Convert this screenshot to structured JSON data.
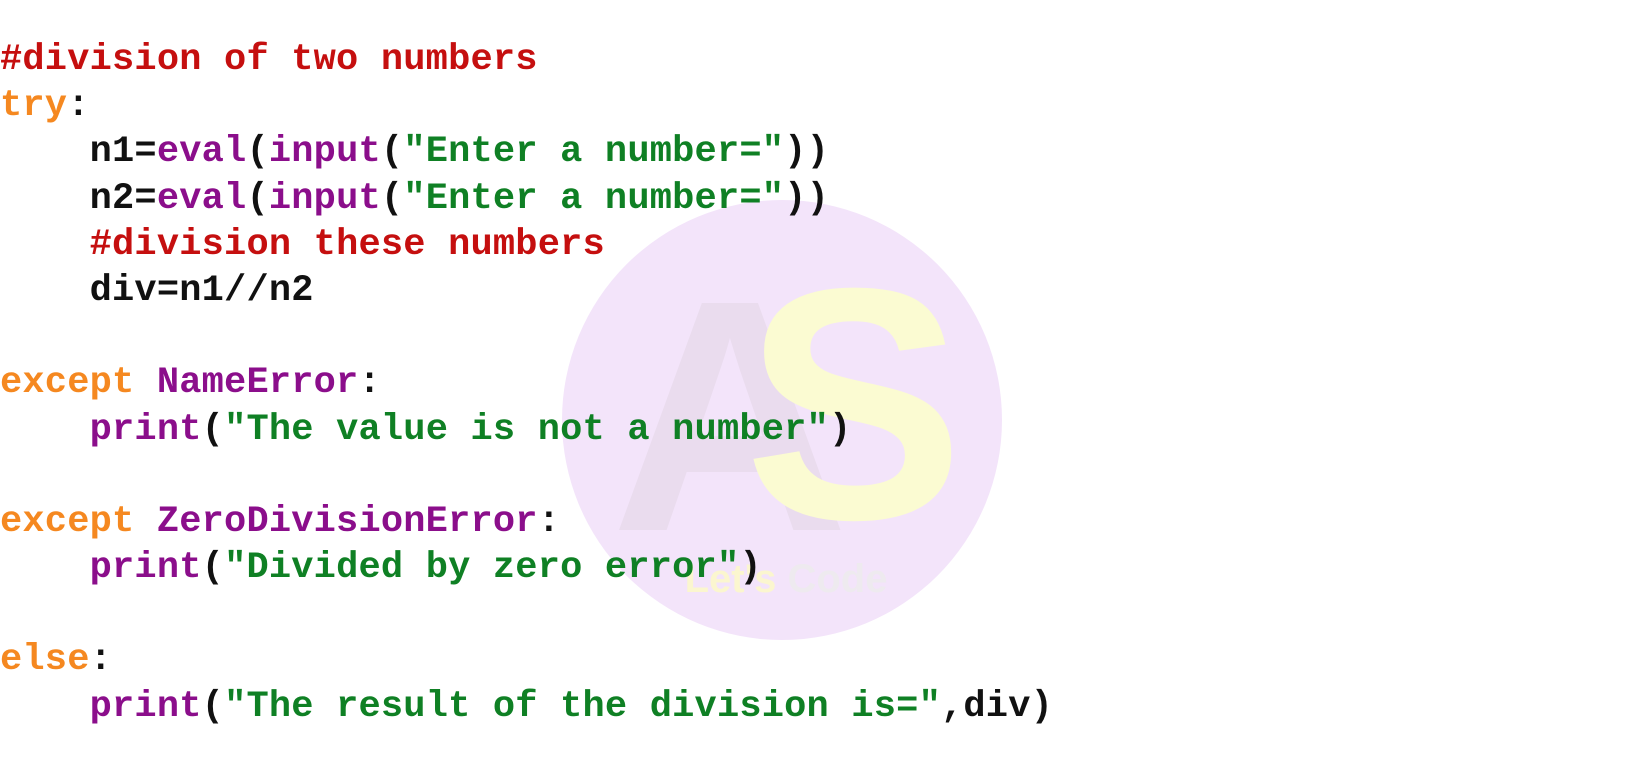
{
  "editor": {
    "language": "python",
    "background_color": "#ffffff",
    "font_size_px": 37,
    "indent": "    "
  },
  "palette": {
    "comment": "#c50f0f",
    "keyword": "#f58820",
    "builtin": "#8b0e8b",
    "exception": "#8b0e8b",
    "string": "#0f8024",
    "plain": "#111111"
  },
  "watermark": {
    "circle_color": "#f3e4fa",
    "letter_a": "A",
    "letter_a_color": "#eadcee",
    "letter_s": "S",
    "letter_s_color": "#fbfbd2",
    "tagline_part1": "Let's",
    "tagline_part1_color": "#fbf6cf",
    "tagline_part2": "Code",
    "tagline_part2_color": "#eeeaef"
  },
  "code": {
    "full_text": "#division of two numbers\ntry:\n    n1=eval(input(\"Enter a number=\"))\n    n2=eval(input(\"Enter a number=\"))\n    #division these numbers\n    div=n1//n2\n\nexcept NameError:\n    print(\"The value is not a number\")\n\nexcept ZeroDivisionError:\n    print(\"Divided by zero error\")\n\nelse:\n    print(\"The result of the division is=\",div)",
    "lines": [
      {
        "n": 1,
        "tokens": [
          {
            "t": "comment",
            "v": "#division of two numbers"
          }
        ]
      },
      {
        "n": 2,
        "tokens": [
          {
            "t": "keyword",
            "v": "try"
          },
          {
            "t": "plain",
            "v": ":"
          }
        ]
      },
      {
        "n": 3,
        "tokens": [
          {
            "t": "plain",
            "v": "    n1="
          },
          {
            "t": "builtin",
            "v": "eval"
          },
          {
            "t": "plain",
            "v": "("
          },
          {
            "t": "builtin",
            "v": "input"
          },
          {
            "t": "plain",
            "v": "("
          },
          {
            "t": "string",
            "v": "\"Enter a number=\""
          },
          {
            "t": "plain",
            "v": "))"
          }
        ]
      },
      {
        "n": 4,
        "tokens": [
          {
            "t": "plain",
            "v": "    n2="
          },
          {
            "t": "builtin",
            "v": "eval"
          },
          {
            "t": "plain",
            "v": "("
          },
          {
            "t": "builtin",
            "v": "input"
          },
          {
            "t": "plain",
            "v": "("
          },
          {
            "t": "string",
            "v": "\"Enter a number=\""
          },
          {
            "t": "plain",
            "v": "))"
          }
        ]
      },
      {
        "n": 5,
        "tokens": [
          {
            "t": "plain",
            "v": "    "
          },
          {
            "t": "comment",
            "v": "#division these numbers"
          }
        ]
      },
      {
        "n": 6,
        "tokens": [
          {
            "t": "plain",
            "v": "    div=n1//n2"
          }
        ]
      },
      {
        "n": 7,
        "tokens": []
      },
      {
        "n": 8,
        "tokens": [
          {
            "t": "keyword",
            "v": "except"
          },
          {
            "t": "plain",
            "v": " "
          },
          {
            "t": "exception",
            "v": "NameError"
          },
          {
            "t": "plain",
            "v": ":"
          }
        ]
      },
      {
        "n": 9,
        "tokens": [
          {
            "t": "plain",
            "v": "    "
          },
          {
            "t": "builtin",
            "v": "print"
          },
          {
            "t": "plain",
            "v": "("
          },
          {
            "t": "string",
            "v": "\"The value is not a number\""
          },
          {
            "t": "plain",
            "v": ")"
          }
        ]
      },
      {
        "n": 10,
        "tokens": []
      },
      {
        "n": 11,
        "tokens": [
          {
            "t": "keyword",
            "v": "except"
          },
          {
            "t": "plain",
            "v": " "
          },
          {
            "t": "exception",
            "v": "ZeroDivisionError"
          },
          {
            "t": "plain",
            "v": ":"
          }
        ]
      },
      {
        "n": 12,
        "tokens": [
          {
            "t": "plain",
            "v": "    "
          },
          {
            "t": "builtin",
            "v": "print"
          },
          {
            "t": "plain",
            "v": "("
          },
          {
            "t": "string",
            "v": "\"Divided by zero error\""
          },
          {
            "t": "plain",
            "v": ")"
          }
        ]
      },
      {
        "n": 13,
        "tokens": []
      },
      {
        "n": 14,
        "tokens": [
          {
            "t": "keyword",
            "v": "else"
          },
          {
            "t": "plain",
            "v": ":"
          }
        ]
      },
      {
        "n": 15,
        "tokens": [
          {
            "t": "plain",
            "v": "    "
          },
          {
            "t": "builtin",
            "v": "print"
          },
          {
            "t": "plain",
            "v": "("
          },
          {
            "t": "string",
            "v": "\"The result of the division is=\""
          },
          {
            "t": "plain",
            "v": ",div)"
          }
        ]
      }
    ]
  }
}
